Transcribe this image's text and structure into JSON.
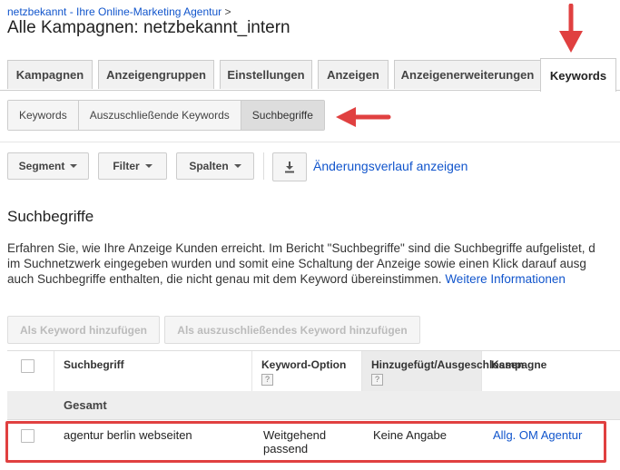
{
  "breadcrumb": {
    "link": "netzbekannt - Ihre Online-Marketing Agentur",
    "sep": ">"
  },
  "title": "Alle Kampagnen: netzbekannt_intern",
  "tabs": [
    "Kampagnen",
    "Anzeigengruppen",
    "Einstellungen",
    "Anzeigen",
    "Anzeigenerweiterungen",
    "Keywords"
  ],
  "active_tab": "Keywords",
  "subtabs": [
    "Keywords",
    "Auszuschließende Keywords",
    "Suchbegriffe"
  ],
  "active_subtab": "Suchbegriffe",
  "toolbar": {
    "segment": "Segment",
    "filter": "Filter",
    "columns": "Spalten",
    "history": "Änderungsverlauf anzeigen"
  },
  "section": {
    "title": "Suchbegriffe",
    "desc_lines": [
      "Erfahren Sie, wie Ihre Anzeige Kunden erreicht. Im Bericht \"Suchbegriffe\" sind die Suchbegriffe aufgelistet, d",
      "im Suchnetzwerk eingegeben wurden und somit eine Schaltung der Anzeige sowie einen Klick darauf ausg",
      "auch Suchbegriffe enthalten, die nicht genau mit dem Keyword übereinstimmen."
    ],
    "more_link": "Weitere Informationen"
  },
  "actions": {
    "add_keyword": "Als Keyword hinzufügen",
    "add_negative": "Als auszuschließendes Keyword hinzufügen"
  },
  "table": {
    "headers": {
      "search_term": "Suchbegriff",
      "match_type": "Keyword-Option",
      "added": "Hinzugefügt/Ausgeschlossen",
      "campaign": "Kampagne",
      "help": "?"
    },
    "total_label": "Gesamt",
    "rows": [
      {
        "search_term": "agentur berlin webseiten",
        "match_type_1": "Weitgehend",
        "match_type_2": "passend",
        "added": "Keine Angabe",
        "campaign": "Allg. OM Agentur"
      }
    ]
  },
  "colors": {
    "link": "#1155cc",
    "annotation": "#e04040"
  }
}
